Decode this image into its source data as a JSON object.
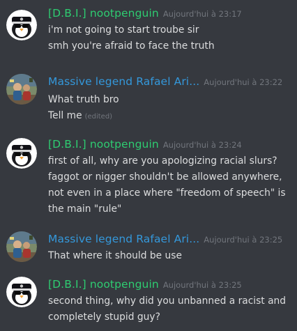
{
  "messages": [
    {
      "author": "[D.B.I.] nootpenguin",
      "timestamp": "Aujourd'hui à 23:17",
      "lines": [
        {
          "text": "i'm not going to start troube sir"
        },
        {
          "text": "smh you're afraid to face the truth"
        }
      ]
    },
    {
      "author": "Massive legend Rafael Ari...",
      "timestamp": "Aujourd'hui à 23:22",
      "lines": [
        {
          "text": "What truth bro"
        },
        {
          "text": "Tell me",
          "edited": "(edited)"
        }
      ]
    },
    {
      "author": "[D.B.I.] nootpenguin",
      "timestamp": "Aujourd'hui à 23:24",
      "lines": [
        {
          "text": "first of all, why are you apologizing racial slurs?"
        },
        {
          "text": "faggot or nigger shouldn't be allowed anywhere,"
        },
        {
          "text": "not even in a place where \"freedom of speech\" is"
        },
        {
          "text": "the main \"rule\""
        }
      ]
    },
    {
      "author": "Massive legend Rafael Ari...",
      "timestamp": "Aujourd'hui à 23:25",
      "lines": [
        {
          "text": "That where it should be use"
        }
      ]
    },
    {
      "author": "[D.B.I.] nootpenguin",
      "timestamp": "Aujourd'hui à 23:25",
      "lines": [
        {
          "text": "second thing, why did you unbanned a racist and"
        },
        {
          "text": "completely stupid guy?"
        }
      ]
    }
  ],
  "colors": {
    "background": "#36393f",
    "author_green": "#2ecc71",
    "author_blue": "#3498db",
    "timestamp": "#72767d",
    "text": "#dcddde"
  },
  "icons": {
    "penguin_avatar": "police-penguin-avatar-icon",
    "legend_avatar": "legend-user-avatar-icon"
  }
}
